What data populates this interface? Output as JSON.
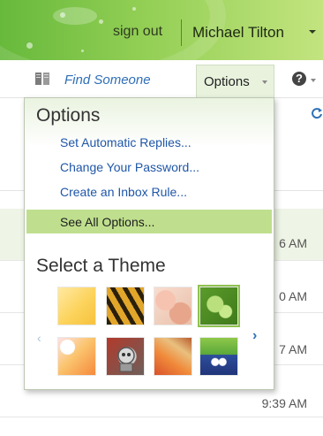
{
  "header": {
    "sign_out": "sign out",
    "user_name": "Michael Tilton"
  },
  "toolbar": {
    "find_someone": "Find Someone",
    "options_label": "Options",
    "help_icon": "?"
  },
  "options_menu": {
    "title": "Options",
    "items": [
      "Set Automatic Replies...",
      "Change Your Password...",
      "Create an Inbox Rule..."
    ],
    "see_all": "See All Options...",
    "theme_title": "Select a Theme",
    "theme_nav_prev": "‹",
    "theme_nav_next": "›",
    "themes": [
      "yellow",
      "tiger",
      "floral-pink",
      "green-leaf",
      "sunrise",
      "robot",
      "autumn-leaves",
      "blue-creature"
    ],
    "active_theme": "green-leaf"
  },
  "message_list": {
    "times": [
      "6 AM",
      "0 AM",
      "7 AM",
      "9:39 AM"
    ]
  },
  "colors": {
    "banner_green": "#93cf55",
    "link_blue": "#1f56a8",
    "highlight_green": "#bfdf8e"
  }
}
